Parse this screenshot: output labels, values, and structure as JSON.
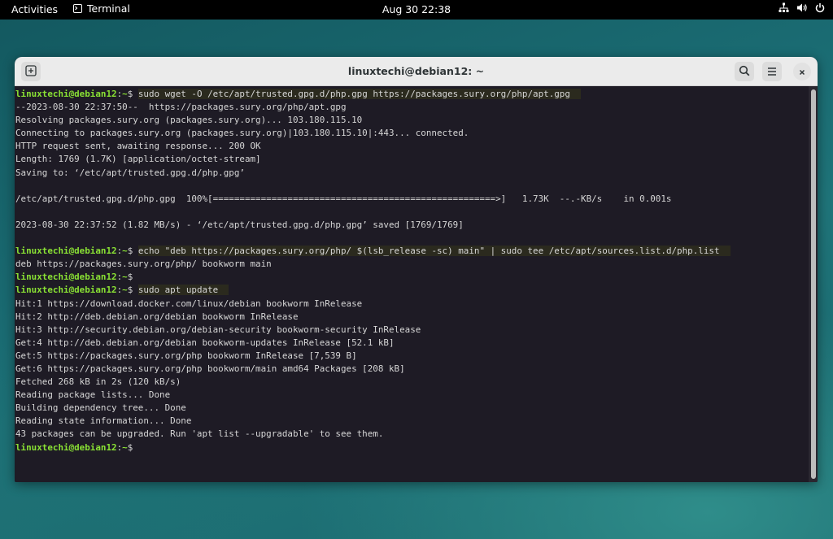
{
  "topbar": {
    "activities": "Activities",
    "app_name": "Terminal",
    "clock": "Aug 30  22:38"
  },
  "window": {
    "title": "linuxtechi@debian12: ~"
  },
  "terminal": {
    "lines": [
      {
        "type": "cmd",
        "user": "linuxtechi@debian12",
        "path": "~",
        "cmd": "sudo wget -O /etc/apt/trusted.gpg.d/php.gpg https://packages.sury.org/php/apt.gpg"
      },
      {
        "type": "out",
        "text": "--2023-08-30 22:37:50--  https://packages.sury.org/php/apt.gpg"
      },
      {
        "type": "out",
        "text": "Resolving packages.sury.org (packages.sury.org)... 103.180.115.10"
      },
      {
        "type": "out",
        "text": "Connecting to packages.sury.org (packages.sury.org)|103.180.115.10|:443... connected."
      },
      {
        "type": "out",
        "text": "HTTP request sent, awaiting response... 200 OK"
      },
      {
        "type": "out",
        "text": "Length: 1769 (1.7K) [application/octet-stream]"
      },
      {
        "type": "out",
        "text": "Saving to: ‘/etc/apt/trusted.gpg.d/php.gpg’"
      },
      {
        "type": "out",
        "text": ""
      },
      {
        "type": "out",
        "text": "/etc/apt/trusted.gpg.d/php.gpg  100%[=====================================================>]   1.73K  --.-KB/s    in 0.001s"
      },
      {
        "type": "out",
        "text": ""
      },
      {
        "type": "out",
        "text": "2023-08-30 22:37:52 (1.82 MB/s) - ‘/etc/apt/trusted.gpg.d/php.gpg’ saved [1769/1769]"
      },
      {
        "type": "out",
        "text": ""
      },
      {
        "type": "cmd",
        "user": "linuxtechi@debian12",
        "path": "~",
        "cmd": "echo \"deb https://packages.sury.org/php/ $(lsb_release -sc) main\" | sudo tee /etc/apt/sources.list.d/php.list"
      },
      {
        "type": "out",
        "text": "deb https://packages.sury.org/php/ bookworm main"
      },
      {
        "type": "cmd",
        "user": "linuxtechi@debian12",
        "path": "~",
        "cmd": ""
      },
      {
        "type": "cmd",
        "user": "linuxtechi@debian12",
        "path": "~",
        "cmd": "sudo apt update"
      },
      {
        "type": "out",
        "text": "Hit:1 https://download.docker.com/linux/debian bookworm InRelease"
      },
      {
        "type": "out",
        "text": "Hit:2 http://deb.debian.org/debian bookworm InRelease"
      },
      {
        "type": "out",
        "text": "Hit:3 http://security.debian.org/debian-security bookworm-security InRelease"
      },
      {
        "type": "out",
        "text": "Get:4 http://deb.debian.org/debian bookworm-updates InRelease [52.1 kB]"
      },
      {
        "type": "out",
        "text": "Get:5 https://packages.sury.org/php bookworm InRelease [7,539 B]"
      },
      {
        "type": "out",
        "text": "Get:6 https://packages.sury.org/php bookworm/main amd64 Packages [208 kB]"
      },
      {
        "type": "out",
        "text": "Fetched 268 kB in 2s (120 kB/s)"
      },
      {
        "type": "out",
        "text": "Reading package lists... Done"
      },
      {
        "type": "out",
        "text": "Building dependency tree... Done"
      },
      {
        "type": "out",
        "text": "Reading state information... Done"
      },
      {
        "type": "out",
        "text": "43 packages can be upgraded. Run 'apt list --upgradable' to see them."
      },
      {
        "type": "cmd",
        "user": "linuxtechi@debian12",
        "path": "~",
        "cmd": ""
      }
    ]
  },
  "icons": {
    "new_tab": "plus-icon",
    "search": "search-icon",
    "menu": "hamburger-menu-icon",
    "close": "close-icon",
    "network": "network-icon",
    "volume": "volume-icon",
    "power": "power-icon",
    "terminal_app": "terminal-app-icon"
  },
  "colors": {
    "prompt_user": "#8ae234",
    "terminal_bg": "#1e1b25",
    "terminal_fg": "#d6d6d6"
  }
}
